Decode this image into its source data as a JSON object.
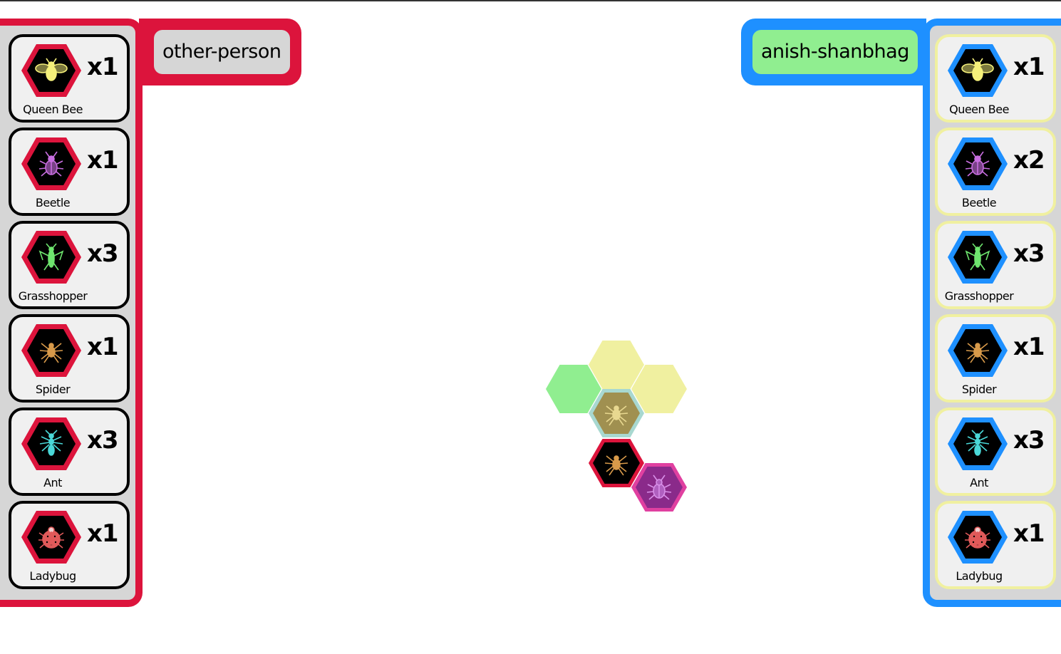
{
  "players": {
    "left": {
      "name": "other-person",
      "color": "#dc143c",
      "name_bg": "#d6d6d6",
      "pieces": [
        {
          "label": "Queen Bee",
          "count": "x1",
          "icon": "bee-icon",
          "icon_color": "#f5f07a"
        },
        {
          "label": "Beetle",
          "count": "x1",
          "icon": "beetle-icon",
          "icon_color": "#c86ee0"
        },
        {
          "label": "Grasshopper",
          "count": "x3",
          "icon": "grasshopper-icon",
          "icon_color": "#6ee66e"
        },
        {
          "label": "Spider",
          "count": "x1",
          "icon": "spider-icon",
          "icon_color": "#d89a4a"
        },
        {
          "label": "Ant",
          "count": "x3",
          "icon": "ant-icon",
          "icon_color": "#4ad8d8"
        },
        {
          "label": "Ladybug",
          "count": "x1",
          "icon": "ladybug-icon",
          "icon_color": "#e05a5a"
        }
      ]
    },
    "right": {
      "name": "anish-shanbhag",
      "color": "#1e90ff",
      "name_bg": "#90ee90",
      "pieces": [
        {
          "label": "Queen Bee",
          "count": "x1",
          "icon": "bee-icon",
          "icon_color": "#f5f07a"
        },
        {
          "label": "Beetle",
          "count": "x2",
          "icon": "beetle-icon",
          "icon_color": "#c86ee0"
        },
        {
          "label": "Grasshopper",
          "count": "x3",
          "icon": "grasshopper-icon",
          "icon_color": "#6ee66e"
        },
        {
          "label": "Spider",
          "count": "x1",
          "icon": "spider-icon",
          "icon_color": "#d89a4a"
        },
        {
          "label": "Ant",
          "count": "x3",
          "icon": "ant-icon",
          "icon_color": "#4ad8d8"
        },
        {
          "label": "Ladybug",
          "count": "x1",
          "icon": "ladybug-icon",
          "icon_color": "#e05a5a"
        }
      ]
    }
  },
  "board": {
    "tiles": [
      {
        "kind": "move-target",
        "color": "#f0f0a0"
      },
      {
        "kind": "move-target",
        "color": "#90ee90"
      },
      {
        "kind": "move-target",
        "color": "#f0f0a0"
      },
      {
        "kind": "selected-piece",
        "piece": "spider-icon",
        "border": "#a8d8d0",
        "fill": "#a09050"
      },
      {
        "kind": "piece",
        "piece": "spider-icon",
        "border": "#dc143c",
        "fill": "#000000"
      },
      {
        "kind": "piece",
        "piece": "beetle-icon",
        "border": "#e040a0",
        "fill": "#8a2a8a"
      }
    ]
  },
  "colors": {
    "card_border_left": "#000000",
    "card_border_right": "#f0f0a0",
    "panel_bg": "#d6d6d6"
  }
}
